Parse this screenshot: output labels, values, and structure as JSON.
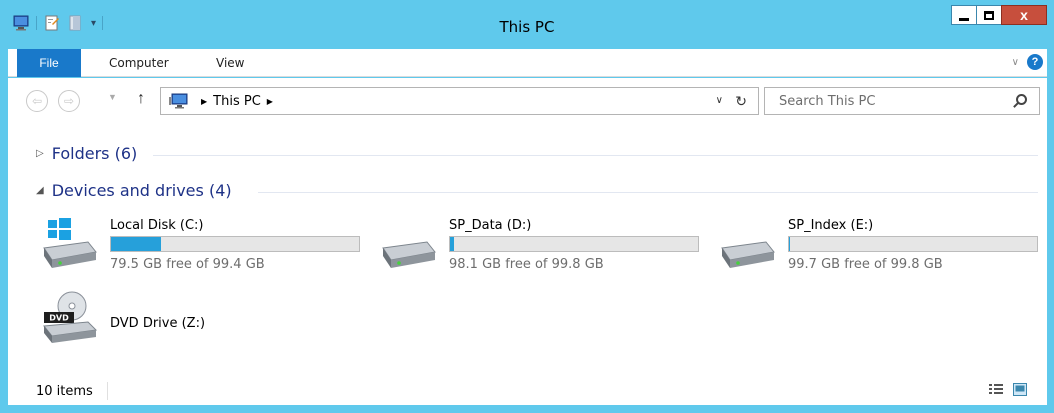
{
  "window": {
    "title": "This PC",
    "accent_color": "#5fc9ec",
    "close_glyph": "x"
  },
  "ribbon": {
    "file_tab": "File",
    "tabs": [
      "Computer",
      "View"
    ],
    "help_glyph": "?"
  },
  "nav": {
    "address_path": "This PC",
    "search_placeholder": "Search This PC"
  },
  "groups": {
    "folders": "Folders (6)",
    "devices": "Devices and drives (4)"
  },
  "drives": [
    {
      "name": "Local Disk (C:)",
      "free_text": "79.5 GB free of 99.4 GB",
      "used_fraction": 0.2,
      "icon": "windows-drive-icon"
    },
    {
      "name": "SP_Data (D:)",
      "free_text": "98.1 GB free of 99.8 GB",
      "used_fraction": 0.017,
      "icon": "hard-drive-icon"
    },
    {
      "name": "SP_Index (E:)",
      "free_text": "99.7 GB free of 99.8 GB",
      "used_fraction": 0.002,
      "icon": "hard-drive-icon"
    }
  ],
  "dvd": {
    "name": "DVD Drive (Z:)",
    "icon": "dvd-drive-icon",
    "badge": "DVD"
  },
  "status": {
    "items_count": "10 items"
  }
}
